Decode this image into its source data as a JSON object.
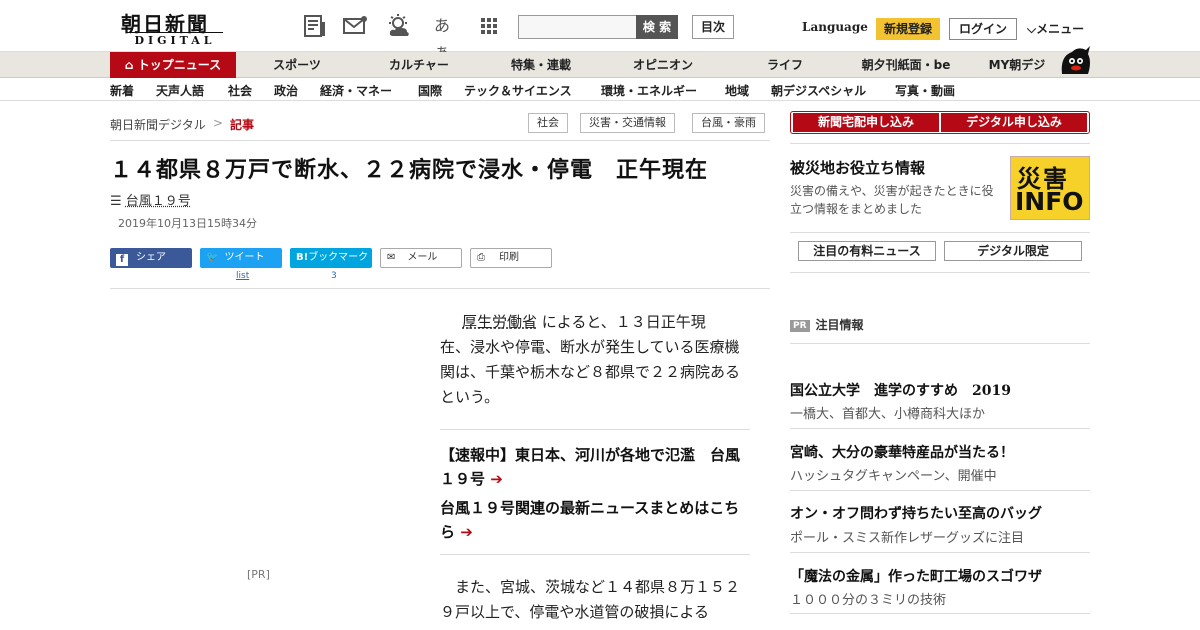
{
  "header": {
    "logo_text": "朝日新聞",
    "logo_sub": "DIGITAL",
    "icons": [
      "newspaper-icon",
      "mail-icon",
      "weather-icon",
      "font-size-icon",
      "grid-menu-icon"
    ],
    "font_icon_text": "あぁ",
    "search_placeholder": "",
    "search_button": "検 索",
    "toc_button": "目次",
    "language_label": "Language",
    "register_label": "新規登録",
    "login_label": "ログイン",
    "menu_label": "メニュー"
  },
  "nav_primary": [
    {
      "label": "トップニュース",
      "active": true
    },
    {
      "label": "スポーツ"
    },
    {
      "label": "カルチャー"
    },
    {
      "label": "特集・連載"
    },
    {
      "label": "オピニオン"
    },
    {
      "label": "ライフ"
    },
    {
      "label": "朝夕刊紙面・be"
    },
    {
      "label": "MY朝デジ"
    }
  ],
  "nav_secondary": [
    "新着",
    "天声人語",
    "社会",
    "政治",
    "経済・マネー",
    "国際",
    "テック＆サイエンス",
    "環境・エネルギー",
    "地域",
    "朝デジスペシャル",
    "写真・動画"
  ],
  "breadcrumb": {
    "home": "朝日新聞デジタル",
    "separator": ">",
    "current": "記事"
  },
  "tags": [
    "社会",
    "災害・交通情報",
    "台風・豪雨"
  ],
  "article": {
    "headline": "１４都県８万戸で断水、２２病院で浸水・停電　正午現在",
    "topic": "台風１９号",
    "date": "2019年10月13日15時34分",
    "share": {
      "facebook": "シェア",
      "twitter": "ツイート",
      "twitter_count": "list",
      "hatena": "ブックマーク",
      "hatena_count": "3",
      "mail": "メール",
      "print": "印刷"
    },
    "pr_label": "[PR]",
    "para1_link": "厚生労働省",
    "para1_line1": "によると、１３日正午現",
    "para1_rest": "在、浸水や停電、断水が発生している医療機関は、千葉や栃木など８都県で２２病院あるという。",
    "related1": "【速報中】東日本、河川が各地で氾濫　台風１９号",
    "related2": "台風１９号関連の最新ニュースまとめはこちら",
    "para2": "また、宮城、茨城など１４都県８万１５２９戸以上で、停電や水道管の破損による"
  },
  "sidebar": {
    "subscribe_home": "新聞宅配申し込み",
    "subscribe_digital": "デジタル申し込み",
    "disaster_title": "被災地お役立ち情報",
    "disaster_desc": "災害の備えや、災害が起きたときに役立つ情報をまとめました",
    "disaster_img_top": "災害",
    "disaster_img_bottom": "INFO",
    "paid_news": "注目の有料ニュース",
    "digital_only": "デジタル限定",
    "pr_badge": "PR",
    "pr_heading": "注目情報",
    "pr_items": [
      {
        "title": "国公立大学　進学のすすめ　2019",
        "sub": "一橋大、首都大、小樽商科大ほか"
      },
      {
        "title": "宮崎、大分の豪華特産品が当たる！",
        "sub": "ハッシュタグキャンペーン、開催中"
      },
      {
        "title": "オン・オフ問わず持ちたい至高のバッグ",
        "sub": "ポール・スミス新作レザーグッズに注目"
      },
      {
        "title": "「魔法の金属」作った町工場のスゴワザ",
        "sub": "１０００分の３ミリの技術"
      }
    ]
  },
  "colors": {
    "brand_red": "#b50a15",
    "register_yellow": "#f2c231",
    "facebook": "#3b5998",
    "twitter": "#1da1f2",
    "hatena": "#00a4de"
  }
}
